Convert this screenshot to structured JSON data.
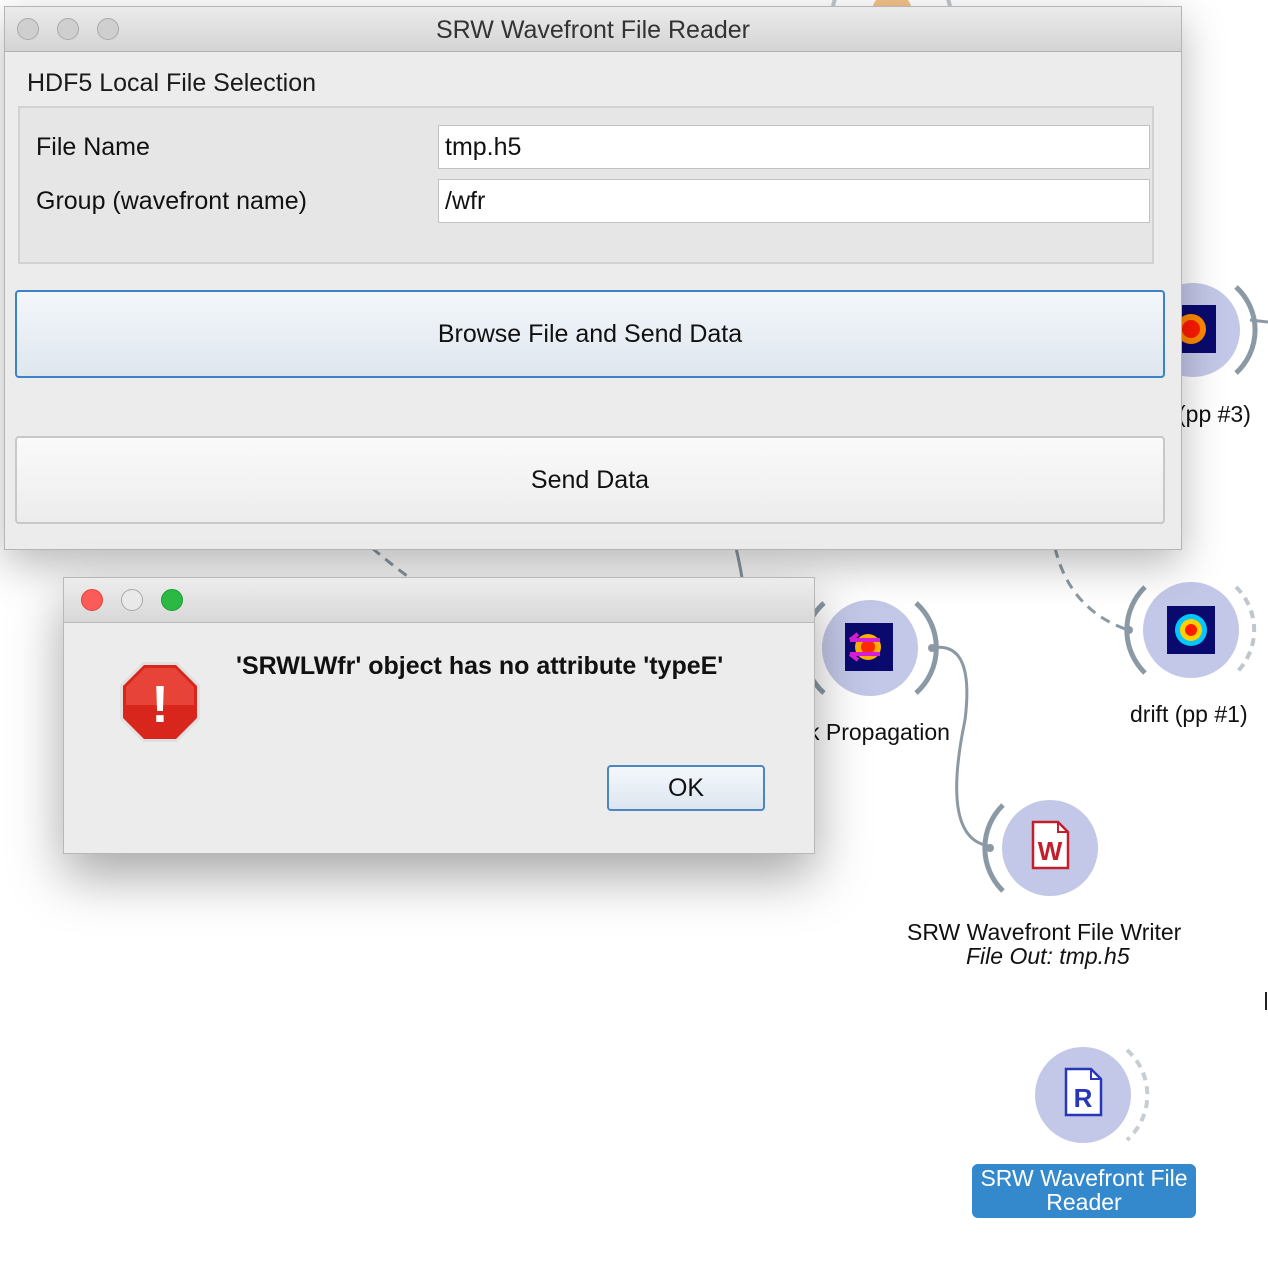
{
  "canvas": {
    "nodes": {
      "pp3_label": "(pp #3)",
      "propagation_label": "k Propagation",
      "drift_label": "drift (pp #1)",
      "writer_label": "SRW Wavefront File Writer",
      "writer_sublabel": "File Out: tmp.h5",
      "reader_label_line1": "SRW Wavefront File",
      "reader_label_line2": "Reader",
      "writer_icon_letter": "W",
      "reader_icon_letter": "R"
    },
    "colors": {
      "node_circle": "#c3c8e8",
      "link": "#8a99a3",
      "selection": "#3489cc"
    }
  },
  "main_window": {
    "title": "SRW Wavefront File Reader",
    "section_title": "HDF5 Local File Selection",
    "file_name_label": "File Name",
    "file_name_value": "tmp.h5",
    "group_label": "Group (wavefront name)",
    "group_value": "/wfr",
    "browse_button": "Browse File and Send Data",
    "send_button": "Send Data"
  },
  "error_dialog": {
    "icon": "stop-alert-icon",
    "icon_glyph": "!",
    "message": "'SRWLWfr' object has no attribute 'typeE'",
    "ok_button": "OK",
    "colors": {
      "close": "#fc5b57",
      "minimize": "#e5e5e5",
      "zoom": "#2aba44",
      "alert": "#d8261c"
    }
  }
}
